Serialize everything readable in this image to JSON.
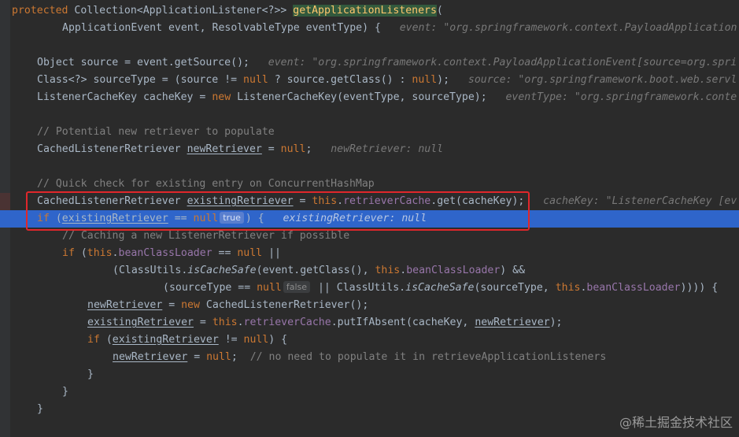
{
  "watermark": "@稀土掘金技术社区",
  "lines": [
    {
      "kind": "code",
      "indent": 0,
      "parts": [
        {
          "t": "protected ",
          "c": "kw"
        },
        {
          "t": "Collection<ApplicationListener<?>> "
        },
        {
          "t": "getApplicationListeners",
          "c": "meth-hl"
        },
        {
          "t": "("
        }
      ]
    },
    {
      "kind": "code",
      "indent": 8,
      "parts": [
        {
          "t": "ApplicationEvent event, ResolvableType eventType) {  "
        },
        {
          "t": " event: \"org.springframework.context.PayloadApplication",
          "c": "hint"
        }
      ]
    },
    {
      "kind": "blank"
    },
    {
      "kind": "code",
      "indent": 4,
      "parts": [
        {
          "t": "Object source = event.getSource();  "
        },
        {
          "t": " event: \"org.springframework.context.PayloadApplicationEvent[source=org.spri",
          "c": "hint"
        }
      ]
    },
    {
      "kind": "code",
      "indent": 4,
      "parts": [
        {
          "t": "Class<?> sourceType = (source != "
        },
        {
          "t": "null",
          "c": "kw"
        },
        {
          "t": " ? source.getClass() : "
        },
        {
          "t": "null",
          "c": "kw"
        },
        {
          "t": ");  "
        },
        {
          "t": " source: \"org.springframework.boot.web.servl",
          "c": "hint"
        }
      ]
    },
    {
      "kind": "code",
      "indent": 4,
      "parts": [
        {
          "t": "ListenerCacheKey cacheKey = "
        },
        {
          "t": "new",
          "c": "kw"
        },
        {
          "t": " ListenerCacheKey(eventType, sourceType);  "
        },
        {
          "t": " eventType: \"org.springframework.conte",
          "c": "hint"
        }
      ]
    },
    {
      "kind": "blank"
    },
    {
      "kind": "code",
      "indent": 4,
      "parts": [
        {
          "t": "// Potential new retriever to populate",
          "c": "cm"
        }
      ]
    },
    {
      "kind": "code",
      "indent": 4,
      "parts": [
        {
          "t": "CachedListenerRetriever "
        },
        {
          "t": "newRetriever",
          "c": "ul"
        },
        {
          "t": " = "
        },
        {
          "t": "null",
          "c": "kw"
        },
        {
          "t": ";  "
        },
        {
          "t": " newRetriever: null",
          "c": "hint"
        }
      ]
    },
    {
      "kind": "blank"
    },
    {
      "kind": "code",
      "indent": 4,
      "parts": [
        {
          "t": "// Quick check for existing entry on ConcurrentHashMap",
          "c": "cm"
        }
      ]
    },
    {
      "kind": "code",
      "indent": 4,
      "warn": true,
      "parts": [
        {
          "t": "CachedListenerRetriever "
        },
        {
          "t": "existingRetriever",
          "c": "ul"
        },
        {
          "t": " = "
        },
        {
          "t": "this",
          "c": "kw"
        },
        {
          "t": "."
        },
        {
          "t": "retrieverCache",
          "c": "fld"
        },
        {
          "t": ".get(cacheKey);  "
        },
        {
          "t": " cacheKey: \"ListenerCacheKey [ev",
          "c": "hint"
        }
      ]
    },
    {
      "kind": "code",
      "indent": 4,
      "exec": true,
      "parts": [
        {
          "t": "if",
          "c": "kw"
        },
        {
          "t": " ("
        },
        {
          "t": "existingRetriever",
          "c": "ul"
        },
        {
          "t": " == "
        },
        {
          "t": "null",
          "c": "kw"
        },
        {
          "t": "true",
          "c": "inlay"
        },
        {
          "t": ") {  "
        },
        {
          "t": " existingRetriever: null",
          "c": "hint"
        }
      ]
    },
    {
      "kind": "code",
      "indent": 8,
      "parts": [
        {
          "t": "// Caching a new ListenerRetriever if possible",
          "c": "cm"
        }
      ]
    },
    {
      "kind": "code",
      "indent": 8,
      "parts": [
        {
          "t": "if",
          "c": "kw"
        },
        {
          "t": " ("
        },
        {
          "t": "this",
          "c": "kw"
        },
        {
          "t": "."
        },
        {
          "t": "beanClassLoader",
          "c": "fld"
        },
        {
          "t": " == "
        },
        {
          "t": "null",
          "c": "kw"
        },
        {
          "t": " ||"
        }
      ]
    },
    {
      "kind": "code",
      "indent": 16,
      "parts": [
        {
          "t": "(ClassUtils."
        },
        {
          "t": "isCacheSafe",
          "c": "it"
        },
        {
          "t": "(event.getClass(), "
        },
        {
          "t": "this",
          "c": "kw"
        },
        {
          "t": "."
        },
        {
          "t": "beanClassLoader",
          "c": "fld"
        },
        {
          "t": ") &&"
        }
      ]
    },
    {
      "kind": "code",
      "indent": 24,
      "parts": [
        {
          "t": "(sourceType == "
        },
        {
          "t": "null",
          "c": "kw"
        },
        {
          "t": "false",
          "c": "inlay"
        },
        {
          "t": " || ClassUtils."
        },
        {
          "t": "isCacheSafe",
          "c": "it"
        },
        {
          "t": "(sourceType, "
        },
        {
          "t": "this",
          "c": "kw"
        },
        {
          "t": "."
        },
        {
          "t": "beanClassLoader",
          "c": "fld"
        },
        {
          "t": ")))) {"
        }
      ]
    },
    {
      "kind": "code",
      "indent": 12,
      "parts": [
        {
          "t": "newRetriever",
          "c": "ul"
        },
        {
          "t": " = "
        },
        {
          "t": "new",
          "c": "kw"
        },
        {
          "t": " CachedListenerRetriever();"
        }
      ]
    },
    {
      "kind": "code",
      "indent": 12,
      "parts": [
        {
          "t": "existingRetriever",
          "c": "ul"
        },
        {
          "t": " = "
        },
        {
          "t": "this",
          "c": "kw"
        },
        {
          "t": "."
        },
        {
          "t": "retrieverCache",
          "c": "fld"
        },
        {
          "t": ".putIfAbsent(cacheKey, "
        },
        {
          "t": "newRetriever",
          "c": "ul"
        },
        {
          "t": ");"
        }
      ]
    },
    {
      "kind": "code",
      "indent": 12,
      "parts": [
        {
          "t": "if",
          "c": "kw"
        },
        {
          "t": " ("
        },
        {
          "t": "existingRetriever",
          "c": "ul"
        },
        {
          "t": " != "
        },
        {
          "t": "null",
          "c": "kw"
        },
        {
          "t": ") {"
        }
      ]
    },
    {
      "kind": "code",
      "indent": 16,
      "parts": [
        {
          "t": "newRetriever",
          "c": "ul"
        },
        {
          "t": " = "
        },
        {
          "t": "null",
          "c": "kw"
        },
        {
          "t": ";  "
        },
        {
          "t": "// no need to populate it in retrieveApplicationListeners",
          "c": "cm"
        }
      ]
    },
    {
      "kind": "code",
      "indent": 12,
      "parts": [
        {
          "t": "}"
        }
      ]
    },
    {
      "kind": "code",
      "indent": 8,
      "parts": [
        {
          "t": "}"
        }
      ]
    },
    {
      "kind": "code",
      "indent": 4,
      "parts": [
        {
          "t": "}"
        }
      ]
    },
    {
      "kind": "blank"
    }
  ]
}
